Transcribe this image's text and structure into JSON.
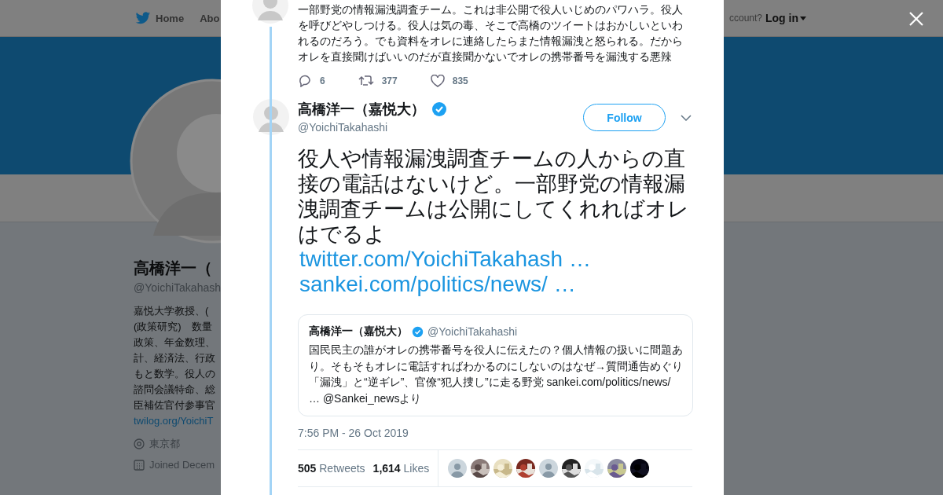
{
  "background_page": {
    "nav": [
      {
        "label": "Home",
        "kind": "home"
      },
      {
        "label": "Abo",
        "kind": "plain"
      }
    ],
    "account_prompt": "ccount?",
    "login": "Log in",
    "profile": {
      "name": "高橋洋一（",
      "handle": "@YoichiTakahash",
      "bio_lines": [
        "嘉悦大学教授、(",
        "(政策研究)　数量",
        "政策、年金数理、",
        "計、経済法、行政",
        "もと数学。役人の",
        "諮問会議特命、総",
        "臣補佐官付参事官"
      ],
      "link": "twilog.org/YoichiT",
      "location": "東京都",
      "joined": "Joined Decem"
    }
  },
  "previous_tweet": {
    "text": "一部野党の情報漏洩調査チーム。これは非公開で役人いじめのパワハラ。役人を呼びどやしつける。役人は気の毒、そこで高橋のツイートはおかしいといわれるのだろう。でも資料をオレに連絡したらまた情報漏洩と怒られる。だからオレを直接聞けばいいのだが直接聞かないでオレの携帯番号を漏洩する悪辣",
    "replies": "6",
    "retweets": "377",
    "likes": "835"
  },
  "tweet": {
    "name": "高橋洋一（嘉悦大）",
    "verified": true,
    "handle": "@YoichiTakahashi",
    "follow_label": "Follow",
    "text": "役人や情報漏洩調査チームの人からの直接の電話はないけど。一部野党の情報漏洩調査チームは公開にしてくれればオレはでるよ",
    "links": [
      "twitter.com/YoichiTakahash …",
      "sankei.com/politics/news/ …"
    ],
    "quoted": {
      "name": "高橋洋一（嘉悦大）",
      "verified": true,
      "handle": "@YoichiTakahashi",
      "text": "国民民主の誰がオレの携帯番号を役人に伝えたの？個人情報の扱いに問題あり。そもそもオレに電話すればわかるのにしないのはなぜ→質問通告めぐり「漏洩」と“逆ギレ”、官僚“犯人捜し”に走る野党 sankei.com/politics/news/ … @Sankei_newsより"
    },
    "timestamp": "7:56 PM - 26 Oct 2019",
    "retweet_count": "505",
    "retweet_label": "Retweets",
    "like_count": "1,614",
    "like_label": "Likes",
    "likers": [
      {
        "kind": "default"
      },
      {
        "kind": "picture"
      },
      {
        "kind": "picture"
      },
      {
        "kind": "picture"
      },
      {
        "kind": "default"
      },
      {
        "kind": "picture"
      },
      {
        "kind": "picture"
      },
      {
        "kind": "picture"
      },
      {
        "kind": "picture"
      }
    ]
  }
}
